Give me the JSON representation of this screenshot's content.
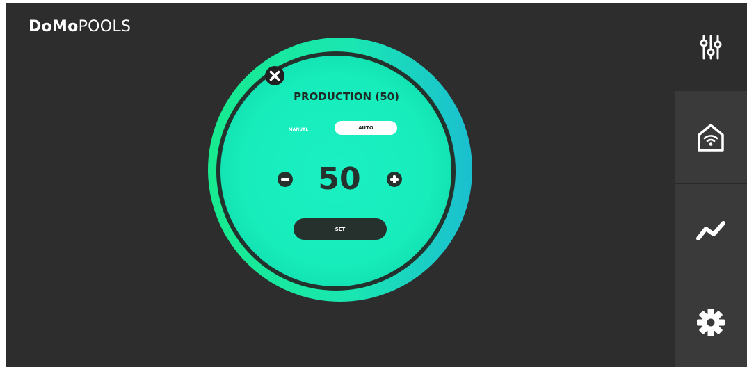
{
  "brand": {
    "bold": "DoMo",
    "light": "POOLS"
  },
  "dialog": {
    "title": "PRODUCTION (50)",
    "modes": {
      "manual": "MANUAL",
      "auto": "AUTO",
      "selected": "AUTO"
    },
    "value": "50",
    "set_label": "SET"
  },
  "sidebar": {
    "items": [
      {
        "icon": "sliders-icon",
        "selected": true
      },
      {
        "icon": "home-wifi-icon",
        "selected": false
      },
      {
        "icon": "trend-icon",
        "selected": false
      },
      {
        "icon": "gear-icon",
        "selected": false
      }
    ]
  },
  "colors": {
    "background": "#2d2d2d",
    "tile": "#3a3a3a",
    "accent_green": "#17ea9c",
    "accent_teal": "#1bbfd0",
    "dark": "#26302c"
  }
}
